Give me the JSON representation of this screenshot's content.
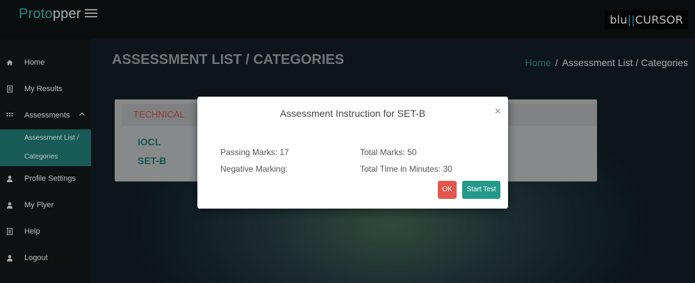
{
  "brand": {
    "part1": "Proto",
    "part2": "pper"
  },
  "header": {
    "logo_left": "blu",
    "logo_bar": "||",
    "logo_right": "CURSOR"
  },
  "sidebar": {
    "items": [
      {
        "label": "Home",
        "icon": "home-icon"
      },
      {
        "label": "My Results",
        "icon": "document-icon"
      },
      {
        "label": "Assessments",
        "icon": "grid-icon"
      },
      {
        "label": "Profile Settings",
        "icon": "user-icon"
      },
      {
        "label": "My Flyer",
        "icon": "user-icon"
      },
      {
        "label": "Help",
        "icon": "document-icon"
      },
      {
        "label": "Logout",
        "icon": "user-icon"
      }
    ],
    "submenu": {
      "line1": "Assessment List /",
      "line2": "Categories"
    }
  },
  "page": {
    "title": "ASSESSMENT LIST / CATEGORIES",
    "breadcrumb": {
      "home": "Home",
      "separator": "/",
      "current": "Assessment List / Categories"
    }
  },
  "card": {
    "tab": "TECHNICAL",
    "items": [
      "IOCL",
      "SET-B"
    ]
  },
  "modal": {
    "title": "Assessment Instruction for SET-B",
    "close": "×",
    "passing_marks": "Passing Marks: 17",
    "total_marks": "Total Marks: 50",
    "negative_marking": "Negative Marking:",
    "total_time": "Total Time in Minutes: 30",
    "ok_label": "OK",
    "start_label": "Start Test"
  },
  "colors": {
    "accent": "#23998b",
    "danger": "#e2564c",
    "tab_text": "#b4463f"
  }
}
